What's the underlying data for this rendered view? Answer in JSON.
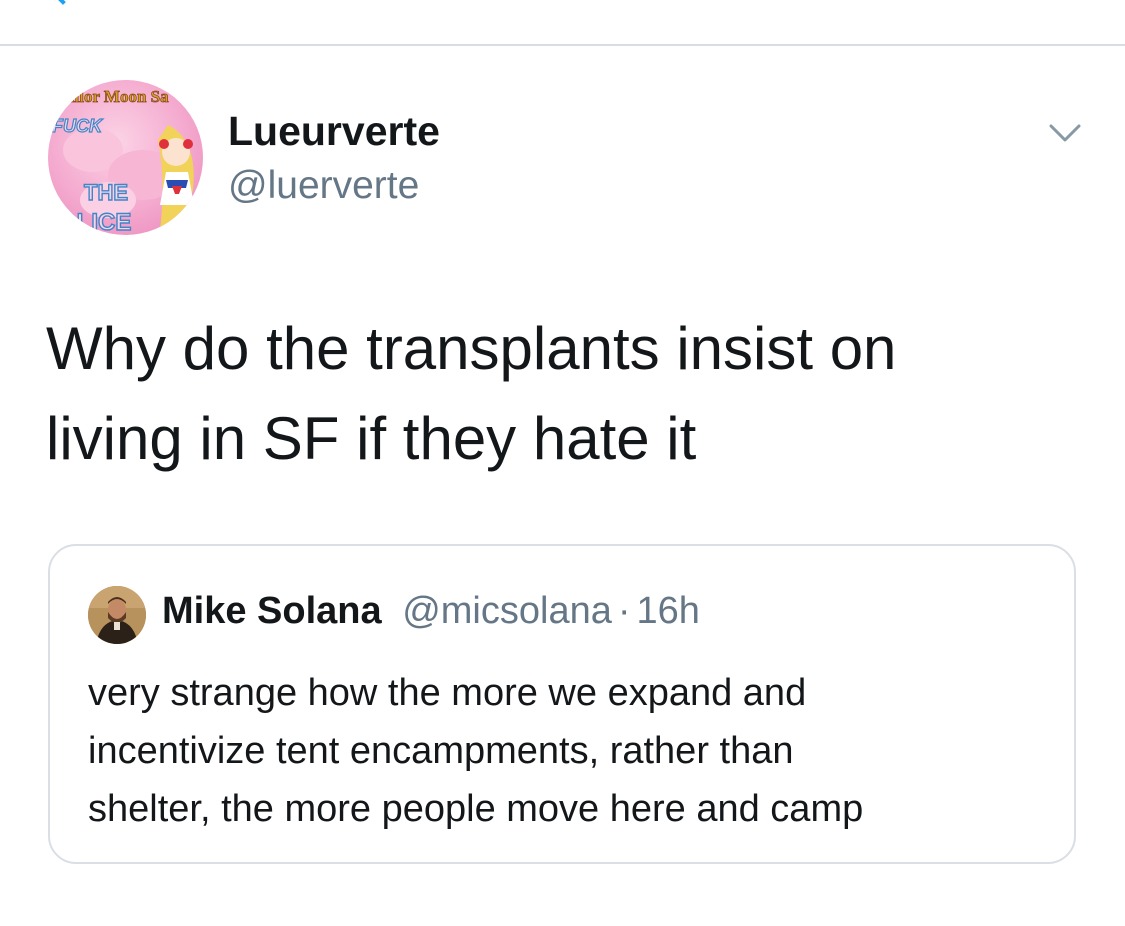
{
  "tweet": {
    "author": {
      "display_name": "Lueurverte",
      "handle": "@luerverte",
      "avatar_text": [
        "ailor Moon Sa",
        "FUCK",
        "THE",
        "OLICE"
      ]
    },
    "text_lines": [
      "Why do the transplants insist on",
      "living in SF if they hate it"
    ]
  },
  "quoted_tweet": {
    "author": {
      "display_name": "Mike Solana",
      "handle": "@micsolana"
    },
    "separator": "·",
    "time": "16h",
    "text_lines": [
      "very strange how the more we expand and",
      "incentivize tent encampments, rather than",
      "shelter, the more people move here and camp"
    ]
  },
  "icons": {
    "more": "chevron-down-icon",
    "back": "back-arrow-icon"
  },
  "colors": {
    "accent": "#1da1f2",
    "text_primary": "#14171a",
    "text_secondary": "#657786",
    "border": "#d9dfe4"
  }
}
